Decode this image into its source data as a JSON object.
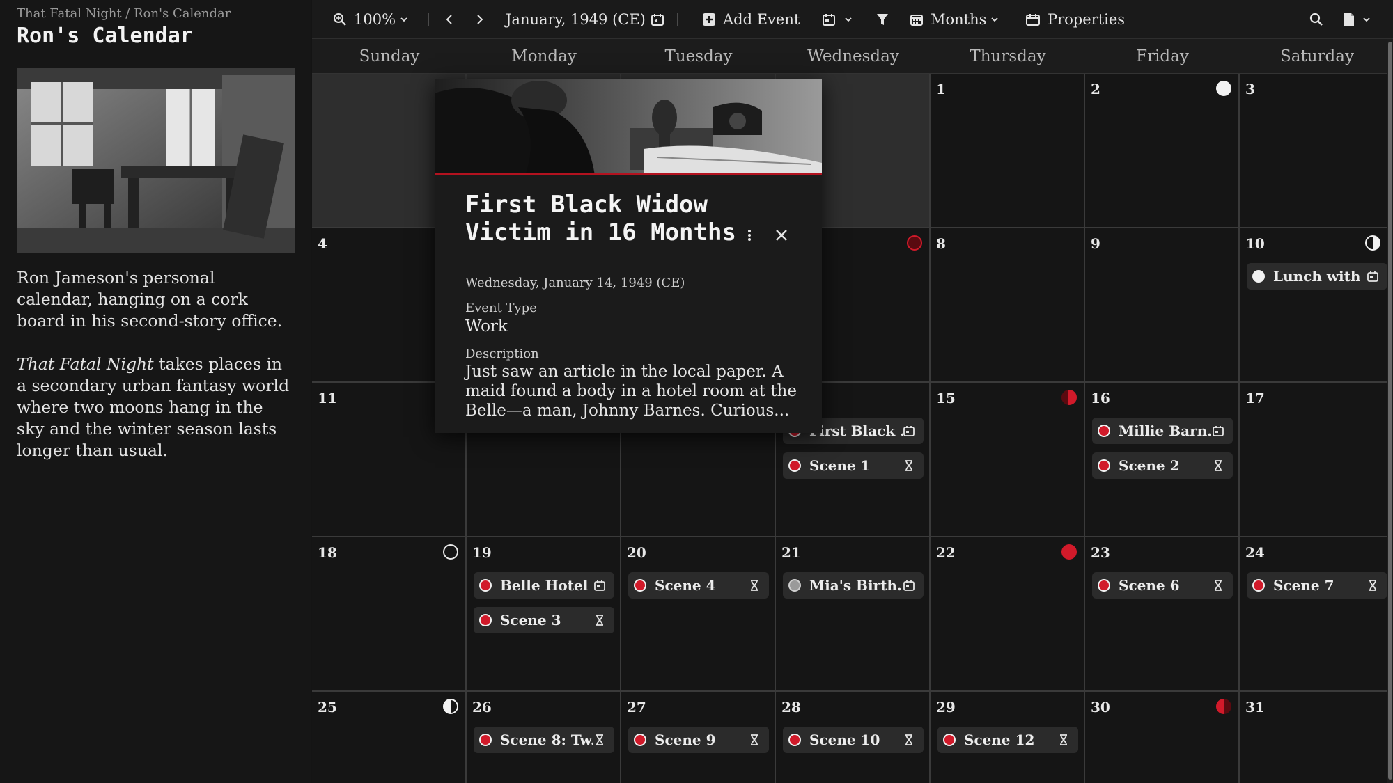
{
  "sidebar": {
    "breadcrumb": "That Fatal Night / Ron's Calendar",
    "title": "Ron's Calendar",
    "description1": "Ron Jameson's personal calendar, hanging on a cork board in his second-story office.",
    "description2_em": "That Fatal Night",
    "description2_rest": " takes places in a secondary urban fantasy world where two moons hang in the sky and the winter season lasts longer than usual."
  },
  "toolbar": {
    "zoom": "100%",
    "date_label": "January, 1949 (CE)",
    "add_event": "Add Event",
    "view_mode": "Months",
    "properties": "Properties"
  },
  "weekdays": [
    "Sunday",
    "Monday",
    "Tuesday",
    "Wednesday",
    "Thursday",
    "Friday",
    "Saturday"
  ],
  "days": {
    "d1": "1",
    "d2": "2",
    "d3": "3",
    "d4": "4",
    "d8": "8",
    "d9": "9",
    "d10": "10",
    "d11": "11",
    "d15": "15",
    "d16": "16",
    "d17": "17",
    "d18": "18",
    "d19": "19",
    "d20": "20",
    "d21": "21",
    "d22": "22",
    "d23": "23",
    "d24": "24",
    "d25": "25",
    "d26": "26",
    "d27": "27",
    "d28": "28",
    "d29": "29",
    "d30": "30",
    "d31": "31"
  },
  "events": {
    "lunch": "Lunch with ...",
    "first_black": "First Black ...",
    "scene1": "Scene 1",
    "millie": "Millie Barn...",
    "scene2": "Scene 2",
    "belle": "Belle Hotel ...",
    "scene3": "Scene 3",
    "scene4": "Scene 4",
    "mia": "Mia's Birth...",
    "scene6": "Scene 6",
    "scene7": "Scene 7",
    "scene8": "Scene 8: Tw...",
    "scene9": "Scene 9",
    "scene10": "Scene 10",
    "scene12": "Scene 12"
  },
  "popup": {
    "title": "First Black Widow Victim in 16 Months",
    "date": "Wednesday, January 14, 1949 (CE)",
    "type_label": "Event Type",
    "type_value": "Work",
    "desc_label": "Description",
    "desc_value": "Just saw an article in the local paper. A maid found a body in a hotel room at the Belle—a man, Johnny Barnes. Curious..."
  },
  "colors": {
    "accent_red": "#d11a2a",
    "background": "#151515",
    "panel": "#1b1b1b"
  }
}
